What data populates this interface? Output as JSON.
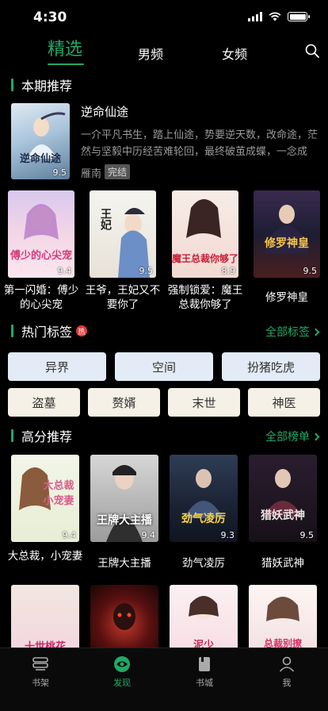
{
  "status": {
    "time": "4:30"
  },
  "tabs": [
    {
      "label": "精选"
    },
    {
      "label": "男频"
    },
    {
      "label": "女频"
    }
  ],
  "current_recommend": {
    "title": "本期推荐",
    "featured": {
      "name": "逆命仙途",
      "cover_text": "逆命仙途",
      "score": "9.5",
      "description": "一介平凡书生，踏上仙途，势要逆天数，改命途，茫然与坚毅中历经苦难轮回，最终破茧成蝶，一念成",
      "author": "雁南",
      "status": "完结"
    },
    "books": [
      {
        "name": "第一闪婚：傅少的心尖宠",
        "cover_text": "傅少的心尖宠",
        "score": "9.4"
      },
      {
        "name": "王爷，王妃又不要你了",
        "cover_text": "王妃",
        "score": "9.5"
      },
      {
        "name": "强制锁爱：魔王总裁你够了",
        "cover_text": "魔王总裁你够了",
        "score": "8.9"
      },
      {
        "name": "修罗神皇",
        "cover_text": "修罗神皇",
        "score": "9.5"
      }
    ]
  },
  "hot_tags": {
    "title": "热门标签",
    "hot_badge": "热",
    "link": "全部标签",
    "tags": [
      "异界",
      "空间",
      "扮猪吃虎",
      "盗墓",
      "赘婿",
      "末世",
      "神医"
    ]
  },
  "high_score": {
    "title": "高分推荐",
    "link": "全部榜单",
    "books": [
      {
        "name": "大总裁，小宠妻",
        "cover_text": "大总裁小宠妻",
        "score": "9.4"
      },
      {
        "name": "王牌大主播",
        "cover_text": "王牌大主播",
        "score": "9.4"
      },
      {
        "name": "劲气凌厉",
        "cover_text": "劲气凌厉",
        "score": "9.3"
      },
      {
        "name": "猎妖武神",
        "cover_text": "猎妖武神",
        "score": "9.5"
      }
    ],
    "row2_covers": [
      "十世桃花",
      "",
      "泥少",
      "总裁别撩"
    ]
  },
  "bottom_nav": [
    {
      "label": "书架"
    },
    {
      "label": "发现"
    },
    {
      "label": "书城"
    },
    {
      "label": "我"
    }
  ],
  "colors": {
    "accent": "#21a867",
    "background": "#000000"
  }
}
